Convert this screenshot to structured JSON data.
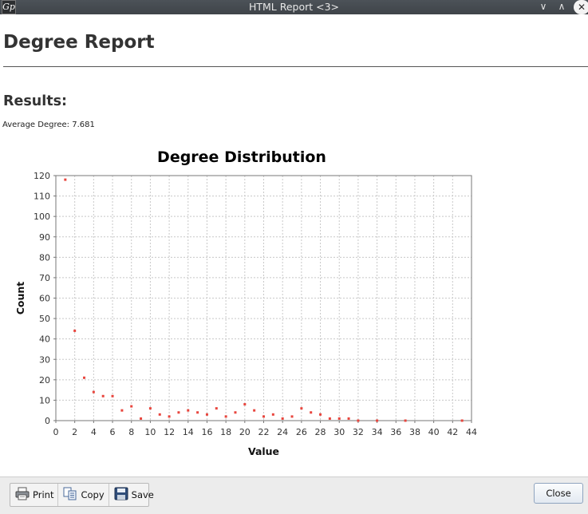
{
  "window": {
    "title": "HTML Report <3>",
    "app_icon_glyph": "Gp",
    "minimize_glyph": "∨",
    "maximize_glyph": "∧",
    "close_glyph": "✕"
  },
  "report": {
    "title": "Degree Report",
    "results_heading": "Results:",
    "average_label": "Average Degree:",
    "average_value": "7.681"
  },
  "chart_data": {
    "type": "scatter",
    "title": "Degree Distribution",
    "xlabel": "Value",
    "ylabel": "Count",
    "xlim": [
      0,
      44
    ],
    "ylim": [
      0,
      120
    ],
    "x_ticks": [
      0,
      2,
      4,
      6,
      8,
      10,
      12,
      14,
      16,
      18,
      20,
      22,
      24,
      26,
      28,
      30,
      32,
      34,
      36,
      38,
      40,
      42,
      44
    ],
    "y_ticks": [
      0,
      10,
      20,
      30,
      40,
      50,
      60,
      70,
      80,
      90,
      100,
      110,
      120
    ],
    "grid": true,
    "point_color": "#e8463e",
    "x": [
      1,
      2,
      3,
      4,
      5,
      6,
      7,
      8,
      9,
      10,
      11,
      12,
      13,
      14,
      15,
      16,
      17,
      18,
      19,
      20,
      21,
      22,
      23,
      24,
      25,
      26,
      27,
      28,
      29,
      30,
      31,
      32,
      34,
      37,
      43
    ],
    "y": [
      118,
      44,
      21,
      14,
      12,
      12,
      5,
      7,
      1,
      6,
      3,
      2,
      4,
      5,
      4,
      3,
      6,
      2,
      4,
      8,
      5,
      2,
      3,
      1,
      2,
      6,
      4,
      3,
      1,
      1,
      1,
      0,
      0,
      0,
      0
    ]
  },
  "toolbar": {
    "print_label": "Print",
    "copy_label": "Copy",
    "save_label": "Save",
    "close_label": "Close",
    "print_icon": "printer-icon",
    "copy_icon": "copy-icon",
    "save_icon": "floppy-disk-icon"
  }
}
